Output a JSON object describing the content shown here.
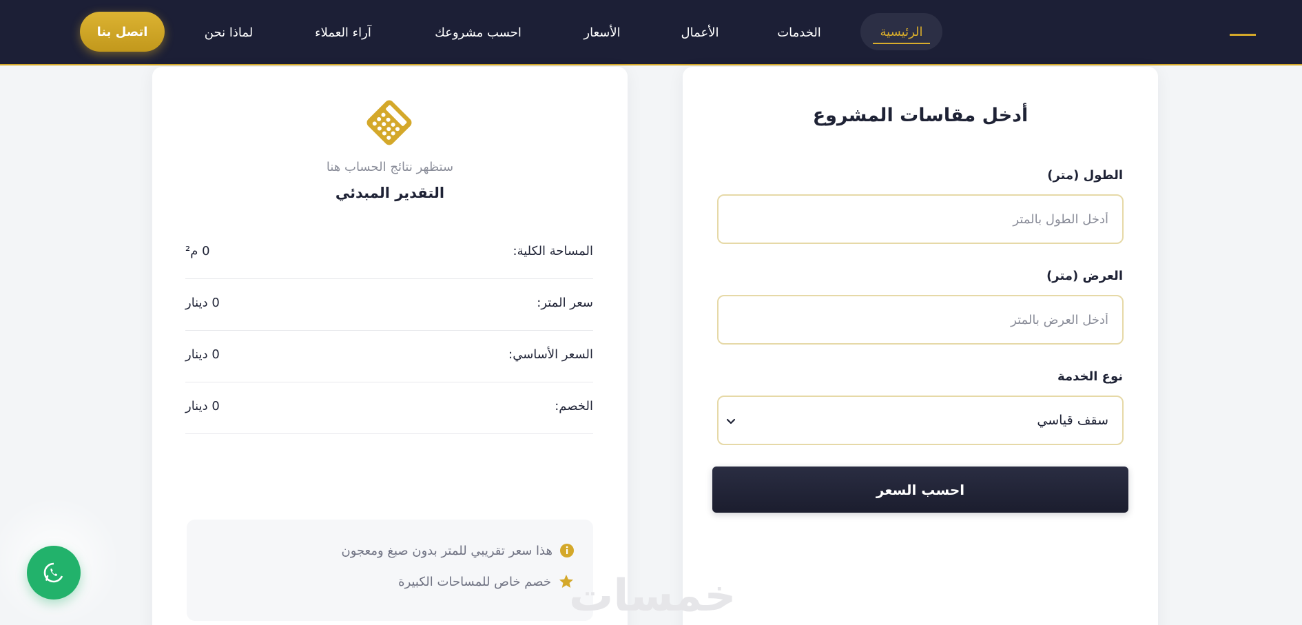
{
  "nav": {
    "items": [
      {
        "key": "home",
        "label": "الرئيسية"
      },
      {
        "key": "services",
        "label": "الخدمات"
      },
      {
        "key": "works",
        "label": "الأعمال"
      },
      {
        "key": "prices",
        "label": "الأسعار"
      },
      {
        "key": "calc",
        "label": "احسب مشروعك"
      },
      {
        "key": "reviews",
        "label": "آراء العملاء"
      },
      {
        "key": "why",
        "label": "لماذا نحن"
      }
    ],
    "contact_label": "اتصل بنا"
  },
  "form": {
    "title": "أدخل مقاسات المشروع",
    "length_label": "الطول (متر)",
    "length_placeholder": "أدخل الطول بالمتر",
    "width_label": "العرض (متر)",
    "width_placeholder": "أدخل العرض بالمتر",
    "service_label": "نوع الخدمة",
    "service_selected": "سقف قياسي",
    "submit_label": "احسب السعر"
  },
  "result": {
    "hint": "ستظهر نتائج الحساب هنا",
    "title": "التقدير المبدئي",
    "rows": [
      {
        "label": "المساحة الكلية:",
        "value": "0 م²"
      },
      {
        "label": "سعر المتر:",
        "value": "0 دينار"
      },
      {
        "label": "السعر الأساسي:",
        "value": "0 دينار"
      },
      {
        "label": "الخصم:",
        "value": "0 دينار"
      }
    ],
    "notes": [
      {
        "icon": "info-icon",
        "text": "هذا سعر تقريبي للمتر بدون صبغ ومعجون"
      },
      {
        "icon": "star-icon",
        "text": "خصم خاص للمساحات الكبيرة"
      }
    ]
  },
  "watermark": "خمسات",
  "colors": {
    "navy": "#1c1f36",
    "gold": "#d4a82a",
    "whatsapp": "#22b26b"
  }
}
